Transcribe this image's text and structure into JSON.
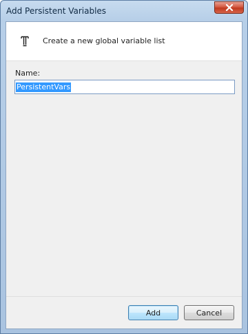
{
  "window": {
    "title": "Add Persistent Variables"
  },
  "banner": {
    "icon": "persistent-variable-icon",
    "description": "Create a new global variable list"
  },
  "form": {
    "name_label": "Name:",
    "name_value": "PersistentVars"
  },
  "buttons": {
    "add_label": "Add",
    "cancel_label": "Cancel"
  },
  "colors": {
    "selection": "#3399ff",
    "close_button": "#c7432b",
    "frame": "#b7cfe8"
  }
}
